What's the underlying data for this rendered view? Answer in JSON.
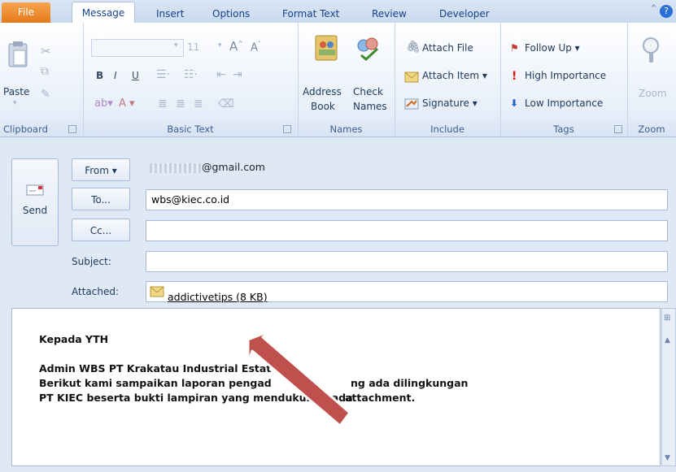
{
  "ribbon_tabs": [
    "File",
    "Message",
    "Insert",
    "Options",
    "Format Text",
    "Review",
    "Developer"
  ],
  "ribbon": {
    "clipboard": {
      "paste": "Paste",
      "label": "Clipboard"
    },
    "basic_text": {
      "font_size": "11",
      "label": "Basic Text"
    },
    "names": {
      "address_book_1": "Address",
      "address_book_2": "Book",
      "check_names_1": "Check",
      "check_names_2": "Names",
      "label": "Names"
    },
    "include": {
      "attach_file": "Attach File",
      "attach_item": "Attach Item ▾",
      "signature": "Signature ▾",
      "label": "Include"
    },
    "tags": {
      "follow_up": "Follow Up ▾",
      "high_importance": "High Importance",
      "low_importance": "Low Importance",
      "label": "Tags"
    },
    "zoom": {
      "button": "Zoom",
      "label": "Zoom"
    }
  },
  "compose": {
    "send": "Send",
    "from_button": "From ▾",
    "from_value": "@gmail.com",
    "to_button": "To...",
    "to_value": "wbs@kiec.co.id",
    "cc_button": "Cc...",
    "subject_label": "Subject:",
    "attached_label": "Attached:",
    "attachment": "addictivetips (8 KB)"
  },
  "body_lines": [
    "Kepada YTH",
    "Admin WBS PT Krakatau Industrial Estat",
    "Berikut kami sampaikan laporan pengad",
    "ng ada dilingkungan",
    "PT KIEC beserta bukti lampiran yang mendukung pada",
    "attachment."
  ],
  "colors": {
    "file_tab": "#e5791c",
    "arrow": "#c0504d",
    "accent": "#15428b"
  }
}
